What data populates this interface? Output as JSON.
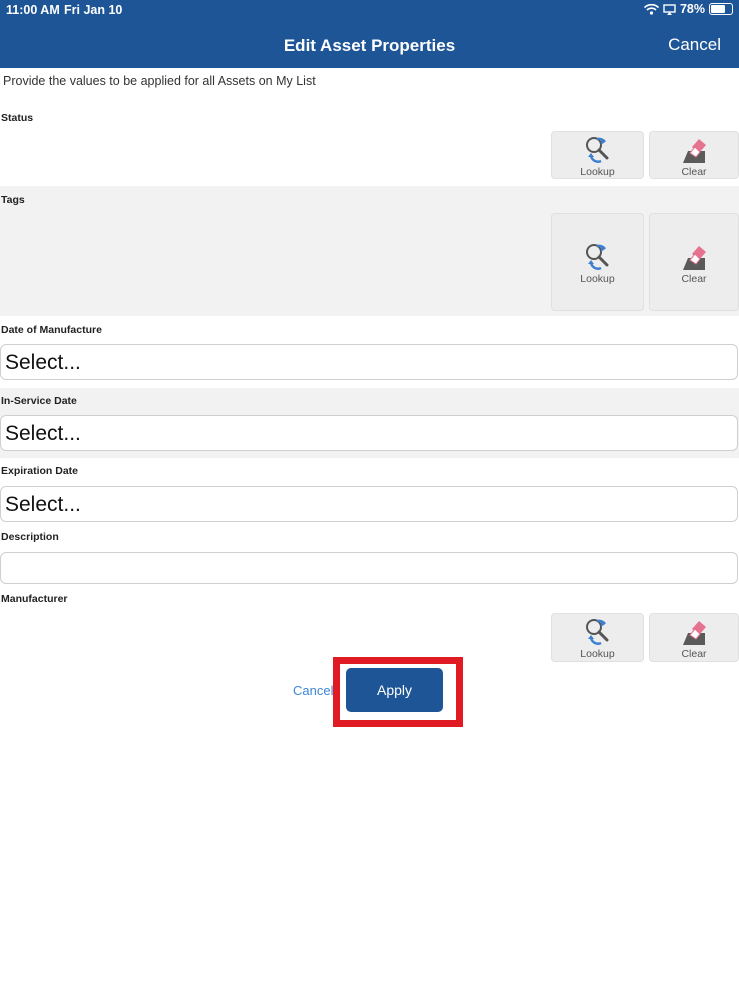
{
  "status_bar": {
    "time": "11:00 AM",
    "date": "Fri Jan 10",
    "battery": "78%",
    "battery_level": 0.78
  },
  "header": {
    "title": "Edit Asset Properties",
    "cancel_label": "Cancel"
  },
  "instruction": "Provide the values to be applied for all Assets on My List",
  "fields": {
    "status": {
      "label": "Status",
      "lookup_label": "Lookup",
      "clear_label": "Clear"
    },
    "tags": {
      "label": "Tags",
      "lookup_label": "Lookup",
      "clear_label": "Clear"
    },
    "date_of_manufacture": {
      "label": "Date of Manufacture",
      "value": "Select..."
    },
    "in_service_date": {
      "label": "In-Service Date",
      "value": "Select..."
    },
    "expiration_date": {
      "label": "Expiration Date",
      "value": "Select..."
    },
    "description": {
      "label": "Description",
      "value": ""
    },
    "manufacturer": {
      "label": "Manufacturer",
      "lookup_label": "Lookup",
      "clear_label": "Clear"
    }
  },
  "footer": {
    "cancel_label": "Cancel",
    "apply_label": "Apply"
  },
  "colors": {
    "header": "#1e5596",
    "link": "#3d86d6",
    "highlight": "#e01b24",
    "tile": "#ededed",
    "alt_section": "#f3f2f3"
  },
  "icons": {
    "lookup": "lookup-icon",
    "clear": "eraser-icon",
    "wifi": "wifi-icon",
    "battery": "battery-icon"
  }
}
